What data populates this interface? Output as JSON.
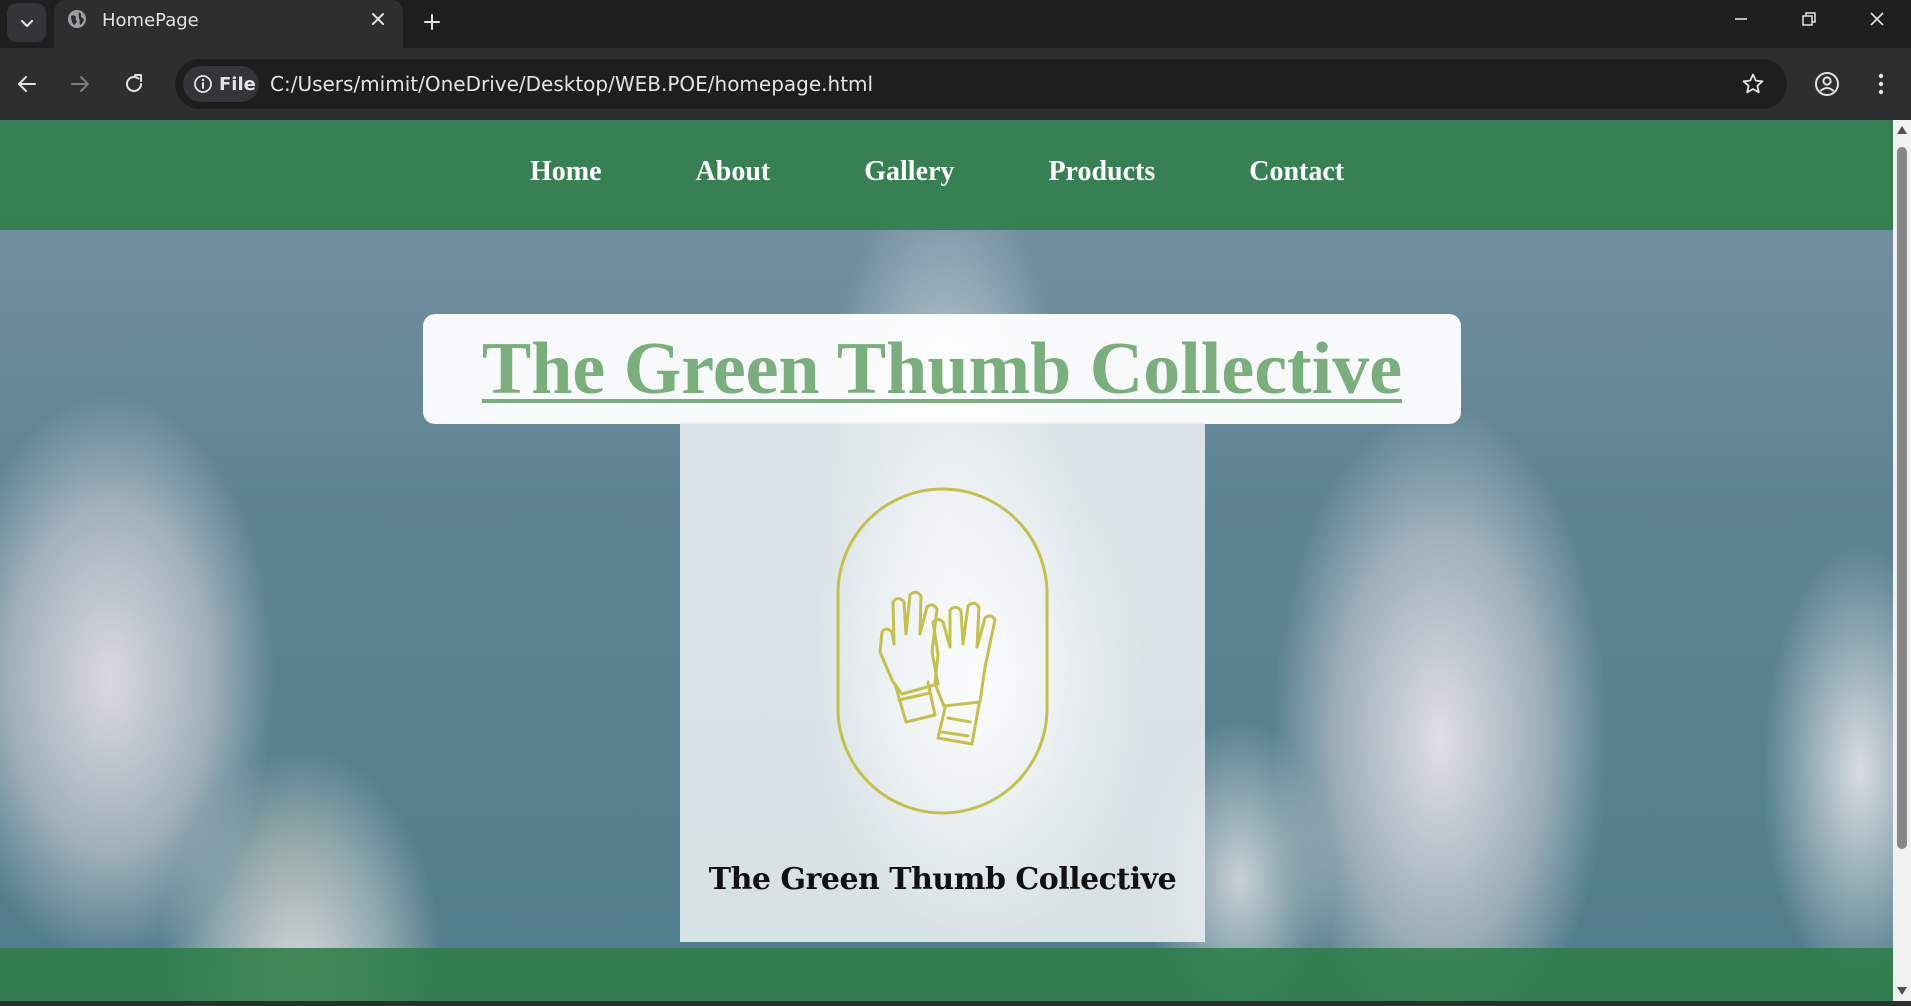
{
  "browser": {
    "tab_title": "HomePage",
    "url": "C:/Users/mimit/OneDrive/Desktop/WEB.POE/homepage.html",
    "site_chip_label": "File"
  },
  "nav": {
    "items": [
      {
        "label": "Home"
      },
      {
        "label": "About"
      },
      {
        "label": "Gallery"
      },
      {
        "label": "Products"
      },
      {
        "label": "Contact"
      }
    ]
  },
  "hero": {
    "title": "The Green Thumb Collective"
  },
  "logo": {
    "wordmark": "The Green Thumb Collective",
    "icon": "gardening-gloves-icon",
    "accent_color": "#c4c04a"
  },
  "colors": {
    "nav_green": "#2e7d48",
    "title_green": "#7aae7c"
  }
}
